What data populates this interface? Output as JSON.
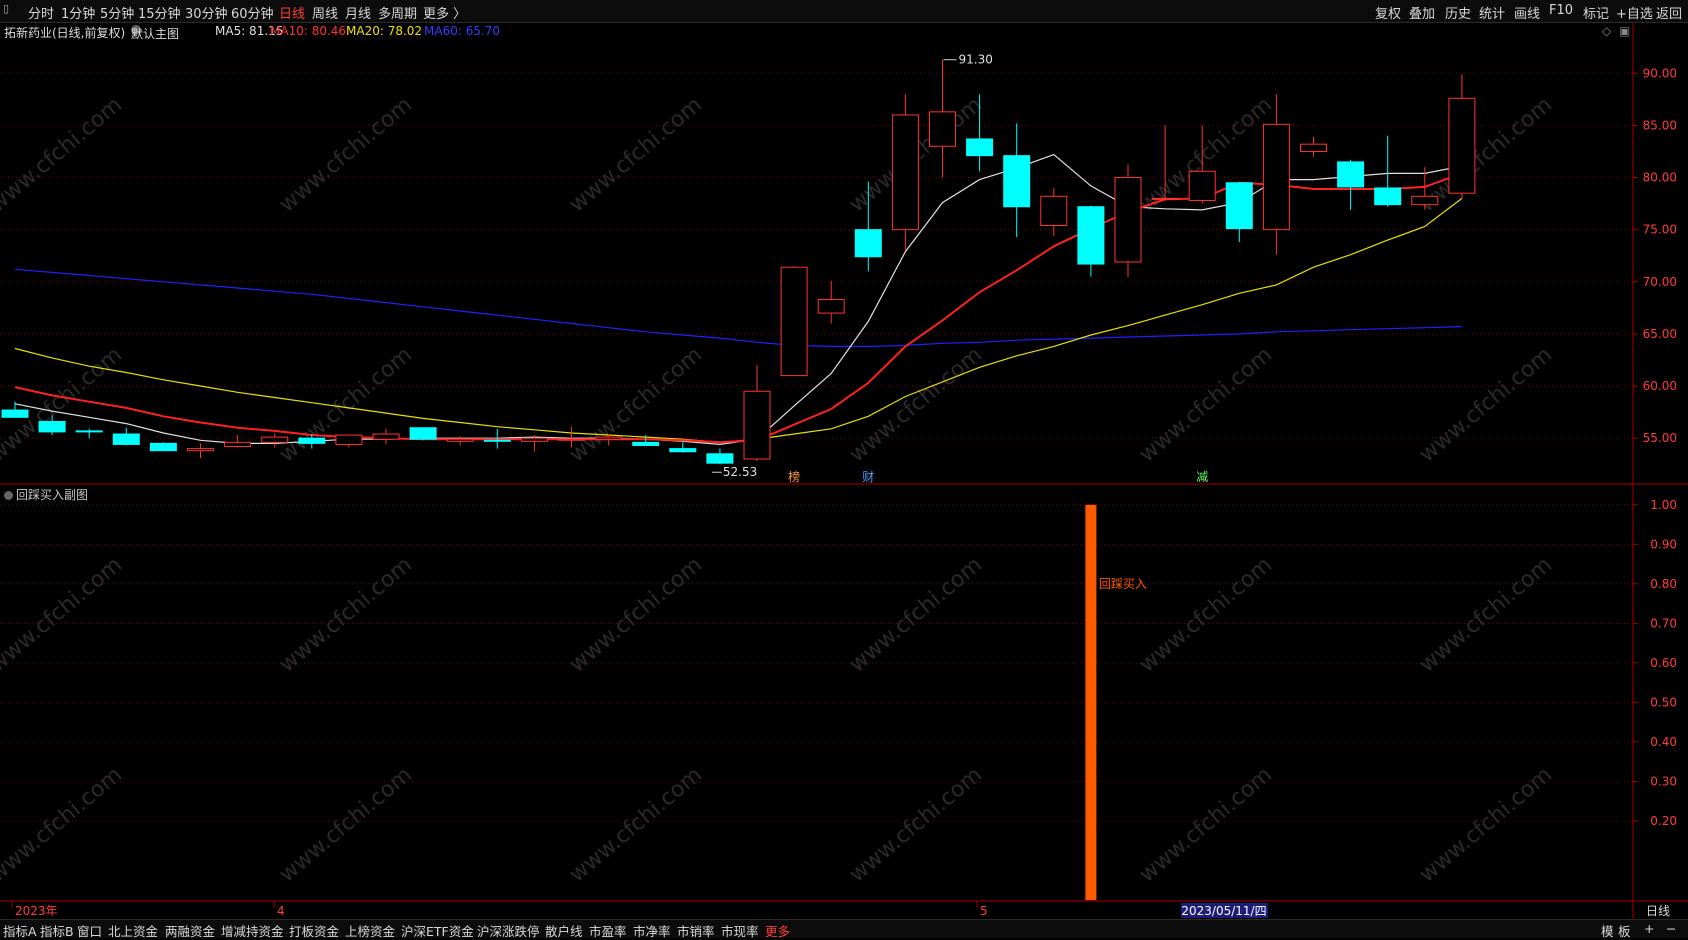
{
  "top_menu": {
    "periods": [
      "分时",
      "1分钟",
      "5分钟",
      "15分钟",
      "30分钟",
      "60分钟",
      "日线",
      "周线",
      "月线",
      "多周期",
      "更多 〉"
    ],
    "active": "日线",
    "right_buttons": [
      "复权",
      "叠加",
      "历史",
      "统计",
      "画线",
      "F10",
      "标记",
      "+自选",
      "返回"
    ]
  },
  "info": {
    "stock": "拓新药业(日线,前复权)",
    "main_label": "默认主图",
    "ma5": "MA5: 81.15",
    "ma10": "MA10: 80.46",
    "ma20": "MA20: 78.02",
    "ma60": "MA60: 65.70"
  },
  "colors": {
    "bg": "#000000",
    "up": "#ff3232",
    "down": "#00ffff",
    "ma5": "#e0e0e0",
    "ma10": "#ff2020",
    "ma20": "#e8e000",
    "ma60": "#2020ff",
    "grid": "#7a0000",
    "axis_text": "#ff3b3b",
    "sub_bar": "#ff5a00"
  },
  "price_axis": {
    "ticks": [
      "90.00",
      "85.00",
      "80.00",
      "75.00",
      "70.00",
      "65.00",
      "60.00",
      "55.00"
    ]
  },
  "sub_axis": {
    "ticks": [
      "1.00",
      "0.90",
      "0.80",
      "0.70",
      "0.60",
      "0.50",
      "0.40",
      "0.30",
      "0.20"
    ]
  },
  "annotations": {
    "high": "91.30",
    "low": "52.53",
    "event_markers": [
      "榜",
      "财",
      "减"
    ],
    "sub_label": "回踩买入"
  },
  "sub_panel_title": "回踩买入副图",
  "time_axis": {
    "labels": [
      "2023年",
      "4",
      "5"
    ],
    "cursor_date": "2023/05/11/四",
    "period_label": "日线"
  },
  "bottom_tabs": [
    "指标A",
    "指标B",
    "窗口",
    "北上资金",
    "两融资金",
    "增减持资金",
    "打板资金",
    "上榜资金",
    "沪深ETF资金",
    "沪深涨跌停",
    "散户线",
    "市盈率",
    "市净率",
    "市销率",
    "市现率",
    "更多"
  ],
  "bottom_right": [
    "模",
    "板",
    "+",
    "−"
  ],
  "watermark": "www.cfchi.com",
  "chart_data": {
    "type": "candlestick",
    "ylim": [
      50.7,
      93.0
    ],
    "candles": [
      {
        "o": 57.7,
        "h": 58.5,
        "l": 57.1,
        "c": 57.0
      },
      {
        "o": 56.6,
        "h": 57.2,
        "l": 55.3,
        "c": 55.6
      },
      {
        "o": 55.7,
        "h": 55.9,
        "l": 55.0,
        "c": 55.6
      },
      {
        "o": 55.4,
        "h": 56.0,
        "l": 54.3,
        "c": 54.4
      },
      {
        "o": 54.5,
        "h": 54.6,
        "l": 53.8,
        "c": 53.8
      },
      {
        "o": 53.8,
        "h": 54.5,
        "l": 53.1,
        "c": 54.0
      },
      {
        "o": 54.2,
        "h": 55.3,
        "l": 54.1,
        "c": 54.6
      },
      {
        "o": 54.6,
        "h": 55.4,
        "l": 54.1,
        "c": 55.1
      },
      {
        "o": 55.0,
        "h": 55.4,
        "l": 54.0,
        "c": 54.5
      },
      {
        "o": 54.4,
        "h": 55.3,
        "l": 54.1,
        "c": 55.3
      },
      {
        "o": 54.9,
        "h": 55.9,
        "l": 54.4,
        "c": 55.4
      },
      {
        "o": 56.0,
        "h": 56.0,
        "l": 54.8,
        "c": 54.9
      },
      {
        "o": 54.7,
        "h": 55.2,
        "l": 54.3,
        "c": 54.9
      },
      {
        "o": 54.8,
        "h": 55.9,
        "l": 54.0,
        "c": 54.7
      },
      {
        "o": 54.7,
        "h": 55.3,
        "l": 53.7,
        "c": 55.0
      },
      {
        "o": 54.8,
        "h": 56.1,
        "l": 54.1,
        "c": 54.9
      },
      {
        "o": 54.9,
        "h": 55.4,
        "l": 54.3,
        "c": 55.1
      },
      {
        "o": 54.6,
        "h": 55.3,
        "l": 54.3,
        "c": 54.3
      },
      {
        "o": 54.0,
        "h": 54.6,
        "l": 53.6,
        "c": 53.7
      },
      {
        "o": 53.5,
        "h": 54.0,
        "l": 52.5,
        "c": 52.6
      },
      {
        "o": 53.0,
        "h": 62.0,
        "l": 52.8,
        "c": 59.5
      },
      {
        "o": 61.0,
        "h": 71.5,
        "l": 61.0,
        "c": 71.4
      },
      {
        "o": 67.0,
        "h": 70.1,
        "l": 66.0,
        "c": 68.3
      },
      {
        "o": 75.0,
        "h": 79.6,
        "l": 71.0,
        "c": 72.4
      },
      {
        "o": 75.0,
        "h": 88.0,
        "l": 73.0,
        "c": 86.0
      },
      {
        "o": 83.0,
        "h": 91.3,
        "l": 80.0,
        "c": 86.3
      },
      {
        "o": 83.7,
        "h": 88.0,
        "l": 80.6,
        "c": 82.1
      },
      {
        "o": 82.1,
        "h": 85.2,
        "l": 74.3,
        "c": 77.2
      },
      {
        "o": 75.4,
        "h": 79.0,
        "l": 74.4,
        "c": 78.2
      },
      {
        "o": 77.2,
        "h": 77.3,
        "l": 70.5,
        "c": 71.7
      },
      {
        "o": 71.9,
        "h": 81.3,
        "l": 70.5,
        "c": 80.0
      },
      {
        "o": 78.0,
        "h": 85.0,
        "l": 77.8,
        "c": 78.0
      },
      {
        "o": 77.8,
        "h": 85.0,
        "l": 77.5,
        "c": 80.6
      },
      {
        "o": 79.5,
        "h": 79.5,
        "l": 73.8,
        "c": 75.1
      },
      {
        "o": 75.0,
        "h": 88.0,
        "l": 72.6,
        "c": 85.1
      },
      {
        "o": 82.5,
        "h": 83.9,
        "l": 82.0,
        "c": 83.2
      },
      {
        "o": 81.5,
        "h": 81.7,
        "l": 76.9,
        "c": 79.1
      },
      {
        "o": 79.0,
        "h": 84.0,
        "l": 77.2,
        "c": 77.4
      },
      {
        "o": 77.4,
        "h": 81.0,
        "l": 76.9,
        "c": 78.2
      },
      {
        "o": 78.5,
        "h": 89.9,
        "l": 78.0,
        "c": 87.6
      }
    ],
    "ma5": [
      58.3,
      57.6,
      57.0,
      56.4,
      55.5,
      54.8,
      54.5,
      54.5,
      54.7,
      54.9,
      54.9,
      55.0,
      55.0,
      55.0,
      55.1,
      55.0,
      55.0,
      54.9,
      54.7,
      54.4,
      54.9,
      58.1,
      61.2,
      66.2,
      72.9,
      77.6,
      79.8,
      80.9,
      82.2,
      79.2,
      77.2,
      77.0,
      76.9,
      77.6,
      79.8,
      79.8,
      80.1,
      80.4,
      80.4,
      81.1
    ],
    "ma10": [
      59.9,
      59.1,
      58.5,
      57.9,
      57.1,
      56.5,
      56.0,
      55.7,
      55.3,
      55.1,
      55.0,
      54.9,
      54.9,
      54.9,
      54.9,
      54.9,
      54.9,
      54.9,
      54.8,
      54.6,
      54.8,
      56.3,
      57.8,
      60.3,
      63.8,
      66.3,
      69.0,
      71.1,
      73.4,
      75.1,
      76.7,
      77.9,
      78.0,
      79.5,
      79.3,
      78.9,
      78.9,
      78.9,
      79.1,
      80.4
    ],
    "ma20": [
      63.6,
      62.7,
      61.9,
      61.3,
      60.6,
      60.0,
      59.4,
      58.9,
      58.4,
      57.9,
      57.4,
      56.9,
      56.5,
      56.1,
      55.8,
      55.5,
      55.3,
      55.1,
      54.9,
      54.6,
      54.9,
      55.4,
      55.9,
      57.1,
      59.0,
      60.4,
      61.8,
      62.9,
      63.8,
      64.9,
      65.8,
      66.8,
      67.8,
      68.9,
      69.7,
      71.4,
      72.6,
      74.0,
      75.3,
      78.0
    ],
    "ma60": [
      71.2,
      70.9,
      70.6,
      70.3,
      70.0,
      69.7,
      69.4,
      69.1,
      68.8,
      68.4,
      68.0,
      67.6,
      67.2,
      66.8,
      66.4,
      66.0,
      65.6,
      65.2,
      64.9,
      64.6,
      64.2,
      63.9,
      63.8,
      63.8,
      63.9,
      64.1,
      64.2,
      64.4,
      64.5,
      64.6,
      64.7,
      64.8,
      64.9,
      65.0,
      65.2,
      65.3,
      65.4,
      65.5,
      65.6,
      65.7
    ],
    "sub": {
      "index": 29,
      "value": 1.0,
      "ylim": [
        0.0,
        1.05
      ]
    }
  }
}
